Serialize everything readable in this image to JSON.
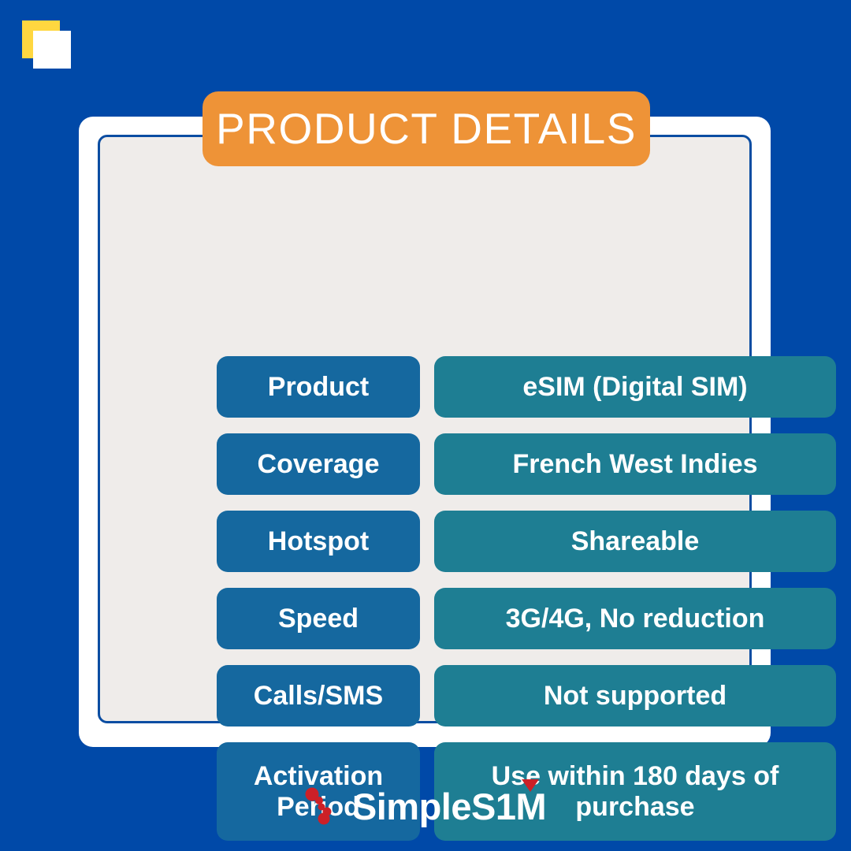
{
  "page": {
    "background_color": "#0049A8",
    "card_color": "#FFFFFF",
    "panel_color": "#EFECEA",
    "panel_border_color": "#0B4DA2",
    "accent_orange": "#EE9337",
    "label_pill_color": "#15689F",
    "value_pill_color": "#1E7E93",
    "decoration_yellow": "#FFD740",
    "logo_red": "#CC2027"
  },
  "header": {
    "title": "PRODUCT DETAILS"
  },
  "details": {
    "rows": [
      {
        "label": "Product",
        "value": "eSIM (Digital SIM)"
      },
      {
        "label": "Coverage",
        "value": "French West Indies"
      },
      {
        "label": "Hotspot",
        "value": "Shareable"
      },
      {
        "label": "Speed",
        "value": "3G/4G, No reduction"
      },
      {
        "label": "Calls/SMS",
        "value": "Not supported"
      },
      {
        "label": "Activation Period",
        "value": "Use within 180 days of purchase"
      }
    ]
  },
  "footer": {
    "brand_name": "SimpleS1M",
    "logo_mark_icon": "dots-diagonal-icon",
    "logo_accent_icon": "triangle-down-icon"
  },
  "decorations": {
    "top_left": {
      "icon": "offset-squares-icon"
    },
    "bottom_right": {
      "icon": "offset-squares-icon"
    }
  }
}
